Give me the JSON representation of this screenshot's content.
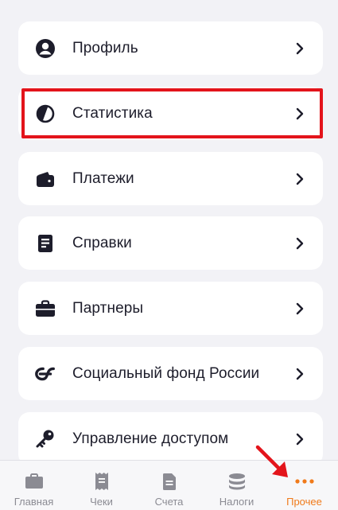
{
  "menu": {
    "items": [
      {
        "label": "Профиль",
        "icon": "profile-icon"
      },
      {
        "label": "Статистика",
        "icon": "pie-chart-icon"
      },
      {
        "label": "Платежи",
        "icon": "wallet-icon"
      },
      {
        "label": "Справки",
        "icon": "document-icon"
      },
      {
        "label": "Партнеры",
        "icon": "briefcase-icon"
      },
      {
        "label": "Социальный фонд России",
        "icon": "social-fund-icon"
      },
      {
        "label": "Управление доступом",
        "icon": "key-icon"
      }
    ]
  },
  "tabbar": {
    "tabs": [
      {
        "label": "Главная",
        "icon": "briefcase-icon"
      },
      {
        "label": "Чеки",
        "icon": "receipt-icon"
      },
      {
        "label": "Счета",
        "icon": "document-icon"
      },
      {
        "label": "Налоги",
        "icon": "coins-icon"
      },
      {
        "label": "Прочее",
        "icon": "more-dots-icon",
        "active": true
      }
    ]
  },
  "colors": {
    "accent": "#f07a1a",
    "highlight": "#e3141b",
    "icon": "#1d1d2b",
    "inactive": "#8b8b93"
  }
}
